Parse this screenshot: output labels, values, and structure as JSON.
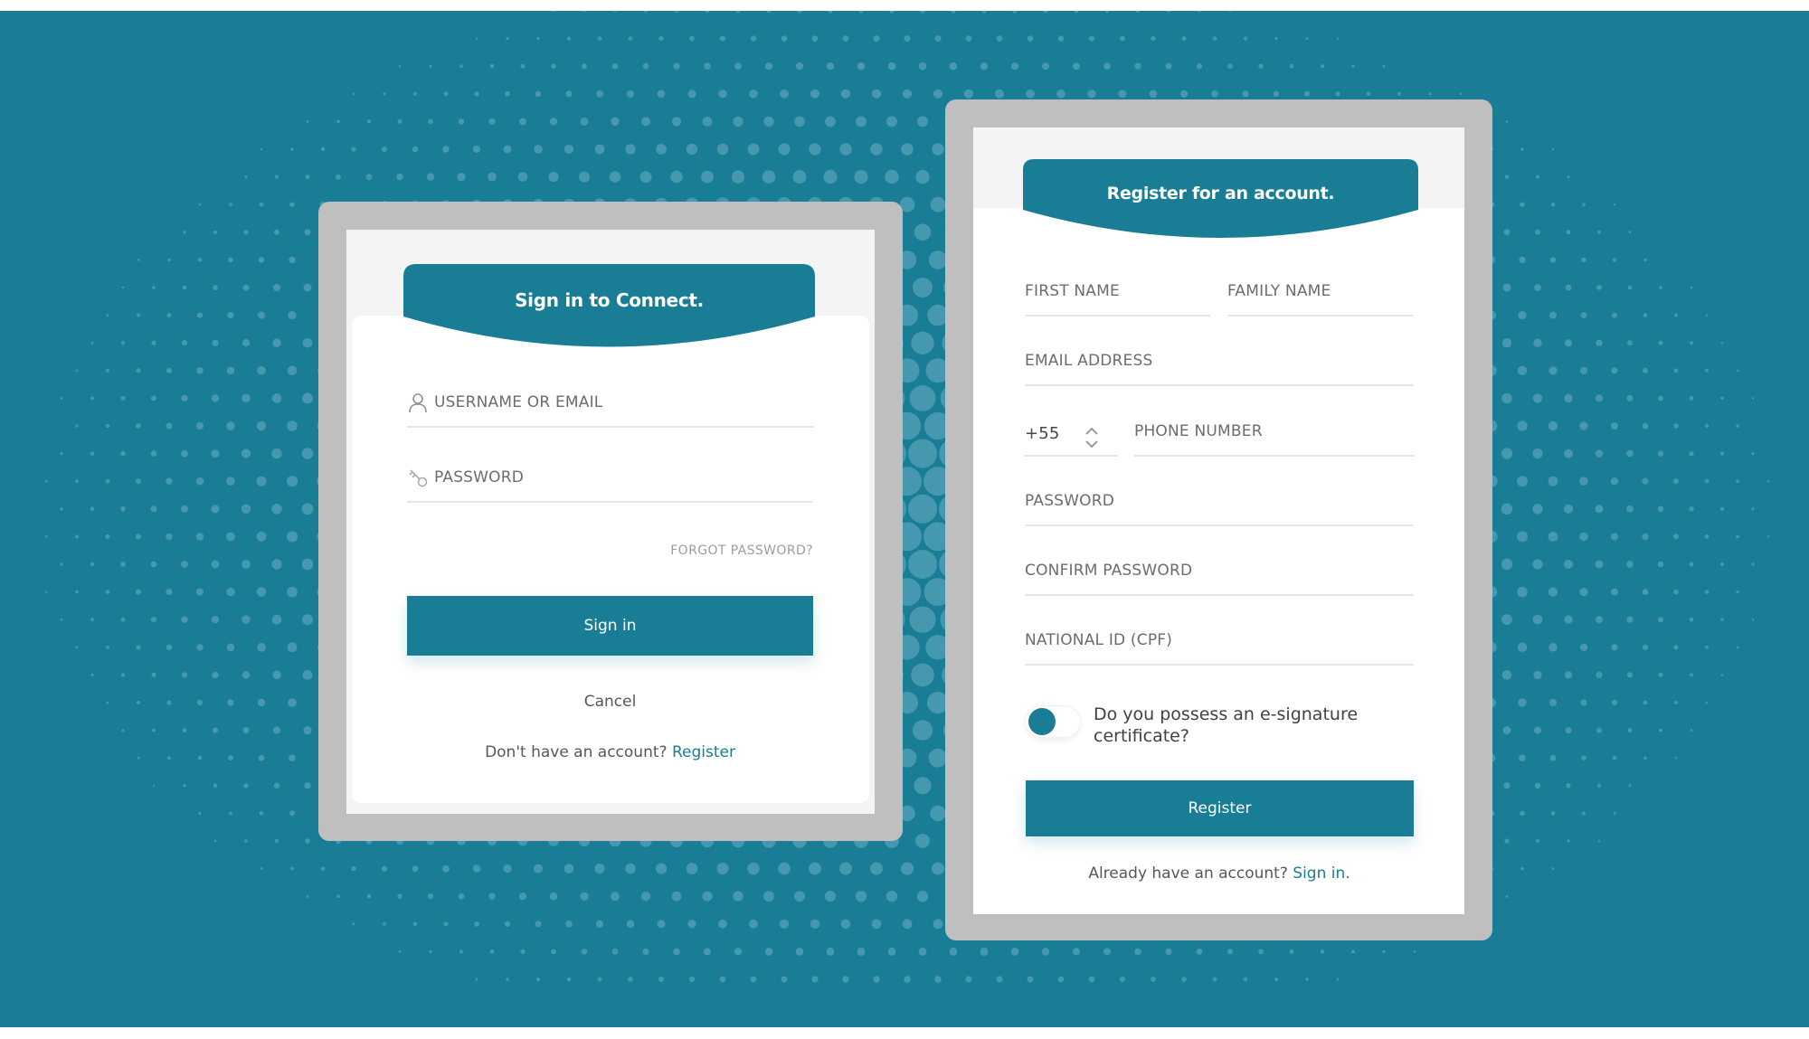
{
  "colors": {
    "accent": "#187d95",
    "background": "#187d95",
    "dots": "#4d9cb1",
    "frame": "#bfbfbf",
    "muted_text": "#6a6d70"
  },
  "signin": {
    "title": "Sign in to Connect.",
    "username_placeholder": "USERNAME OR EMAIL",
    "username_icon": "user-icon",
    "password_placeholder": "PASSWORD",
    "password_icon": "key-icon",
    "forgot_password": "FORGOT PASSWORD?",
    "submit_label": "Sign in",
    "cancel_label": "Cancel",
    "no_account_text": "Don't have an account?",
    "register_link": "Register"
  },
  "register": {
    "title": "Register for an account.",
    "first_name": "FIRST NAME",
    "family_name": "FAMILY NAME",
    "email": "EMAIL ADDRESS",
    "country_code": "+55",
    "phone": "PHONE NUMBER",
    "password": "PASSWORD",
    "confirm_password": "CONFIRM PASSWORD",
    "national_id": "NATIONAL ID (CPF)",
    "esignature_question": "Do you possess an e-signature certificate?",
    "submit_label": "Register",
    "has_account_text": "Already have an account?",
    "signin_link": "Sign in."
  }
}
